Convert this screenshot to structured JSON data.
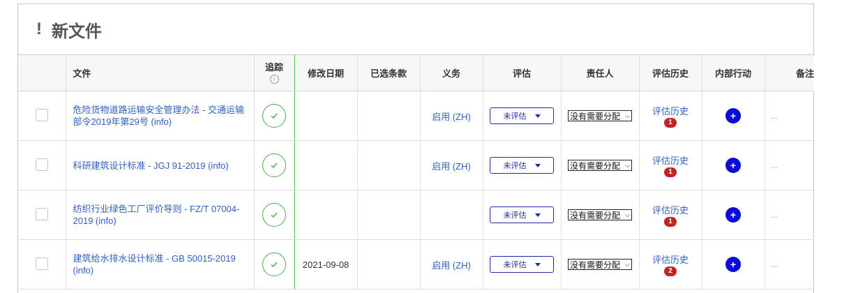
{
  "panel": {
    "bang": "!",
    "title": "新文件"
  },
  "columns": {
    "file": "文件",
    "track": "追踪",
    "track_info": "i",
    "modified": "修改日期",
    "selected": "已选条款",
    "duty": "义务",
    "eval": "评估",
    "owner": "责任人",
    "history": "评估历史",
    "action": "内部行动",
    "notes": "备注"
  },
  "rows": [
    {
      "file": "危险货物道路运输安全管理办法 - 交通运输部令2019年第29号 (info)",
      "modified": "",
      "selected": "",
      "duty": "启用 (ZH)",
      "eval": "未评估",
      "owner": "没有需要分配",
      "history": "评估历史",
      "history_count": "1",
      "plus": "+",
      "notes": "..."
    },
    {
      "file": "科研建筑设计标准 - JGJ 91-2019 (info)",
      "modified": "",
      "selected": "",
      "duty": "启用 (ZH)",
      "eval": "未评估",
      "owner": "没有需要分配",
      "history": "评估历史",
      "history_count": "1",
      "plus": "+",
      "notes": "..."
    },
    {
      "file": "纺织行业绿色工厂评价导则 - FZ/T 07004-2019 (info)",
      "modified": "",
      "selected": "",
      "duty": "",
      "eval": "未评估",
      "owner": "没有需要分配",
      "history": "评估历史",
      "history_count": "1",
      "plus": "+",
      "notes": "..."
    },
    {
      "file": "建筑给水排水设计标准 - GB 50015-2019 (info)",
      "modified": "2021-09-08",
      "selected": "",
      "duty": "启用 (ZH)",
      "eval": "未评估",
      "owner": "没有需要分配",
      "history": "评估历史",
      "history_count": "2",
      "plus": "+",
      "notes": "..."
    }
  ],
  "colors": {
    "link": "#2f5fc3",
    "track_green": "#47b047",
    "badge_red": "#c42222",
    "action_blue": "#0b0bd8",
    "eval_border": "#1e2aa5"
  },
  "icons": {
    "track": "check-circle-icon",
    "action": "plus-circle-icon",
    "select": "chevron-down-icon"
  }
}
